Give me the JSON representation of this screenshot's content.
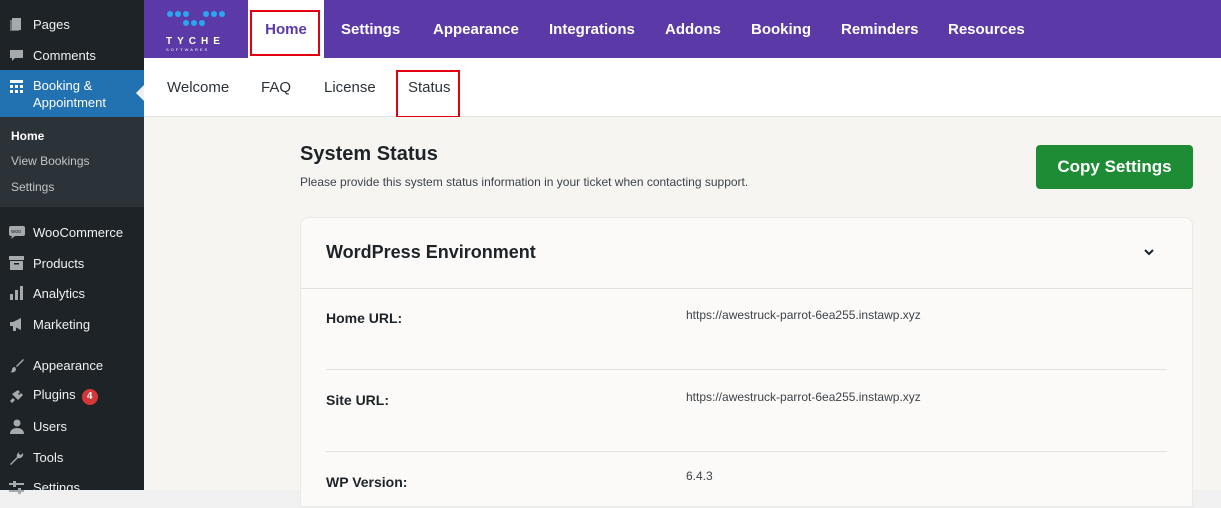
{
  "wp_menu": {
    "pages": "Pages",
    "comments": "Comments",
    "booking": "Booking & Appointment",
    "sub": {
      "home": "Home",
      "view_bookings": "View Bookings",
      "settings": "Settings"
    },
    "woocommerce": "WooCommerce",
    "products": "Products",
    "analytics": "Analytics",
    "marketing": "Marketing",
    "appearance": "Appearance",
    "plugins": "Plugins",
    "plugins_badge": "4",
    "users": "Users",
    "tools": "Tools",
    "settings": "Settings"
  },
  "brand": {
    "logo_text": "TYCHE",
    "logo_sub": "SOFTWARES"
  },
  "top_nav": [
    "Home",
    "Settings",
    "Appearance",
    "Integrations",
    "Addons",
    "Booking",
    "Reminders",
    "Resources"
  ],
  "sub_nav": [
    "Welcome",
    "FAQ",
    "License",
    "Status"
  ],
  "page": {
    "title": "System Status",
    "description": "Please provide this system status information in your ticket when contacting support.",
    "copy_button": "Copy Settings"
  },
  "panel": {
    "title": "WordPress Environment",
    "rows": [
      {
        "label": "Home URL:",
        "value": "https://awestruck-parrot-6ea255.instawp.xyz"
      },
      {
        "label": "Site URL:",
        "value": "https://awestruck-parrot-6ea255.instawp.xyz"
      },
      {
        "label": "WP Version:",
        "value": "6.4.3"
      }
    ]
  },
  "colors": {
    "header": "#5b3aa8",
    "button": "#1e8c34",
    "highlight": "#e0000f",
    "wp_active": "#2271b1"
  }
}
